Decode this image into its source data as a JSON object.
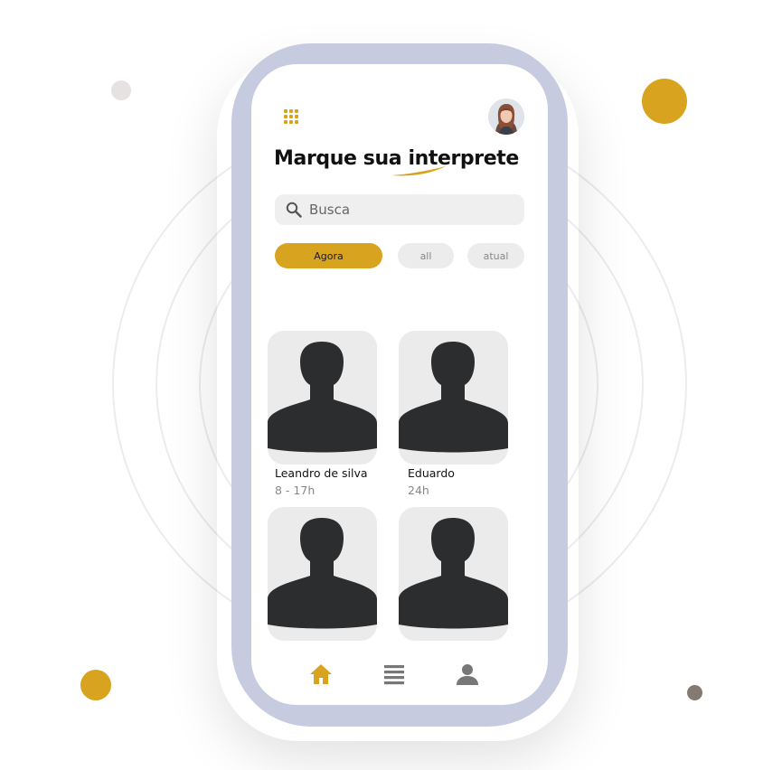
{
  "colors": {
    "accent": "#d8a420",
    "phone_frame": "#c7cbdf",
    "silhouette": "#2b2d2f",
    "card_bg": "#ebebeb"
  },
  "header": {
    "menu_icon": "grid-menu-icon",
    "avatar_icon": "user-avatar",
    "title": "Marque sua interprete"
  },
  "search": {
    "placeholder": "Busca",
    "value": ""
  },
  "filters": [
    {
      "label": "Agora",
      "active": true
    },
    {
      "label": "all",
      "active": false
    },
    {
      "label": "atual",
      "active": false
    }
  ],
  "interpreters": [
    {
      "name": "Leandro de silva",
      "hours": "8 - 17h"
    },
    {
      "name": "Eduardo",
      "hours": "24h"
    },
    {
      "name": "",
      "hours": ""
    },
    {
      "name": "",
      "hours": ""
    }
  ],
  "bottom_nav": [
    {
      "icon": "home-icon",
      "active": true
    },
    {
      "icon": "list-icon",
      "active": false
    },
    {
      "icon": "profile-icon",
      "active": false
    }
  ]
}
